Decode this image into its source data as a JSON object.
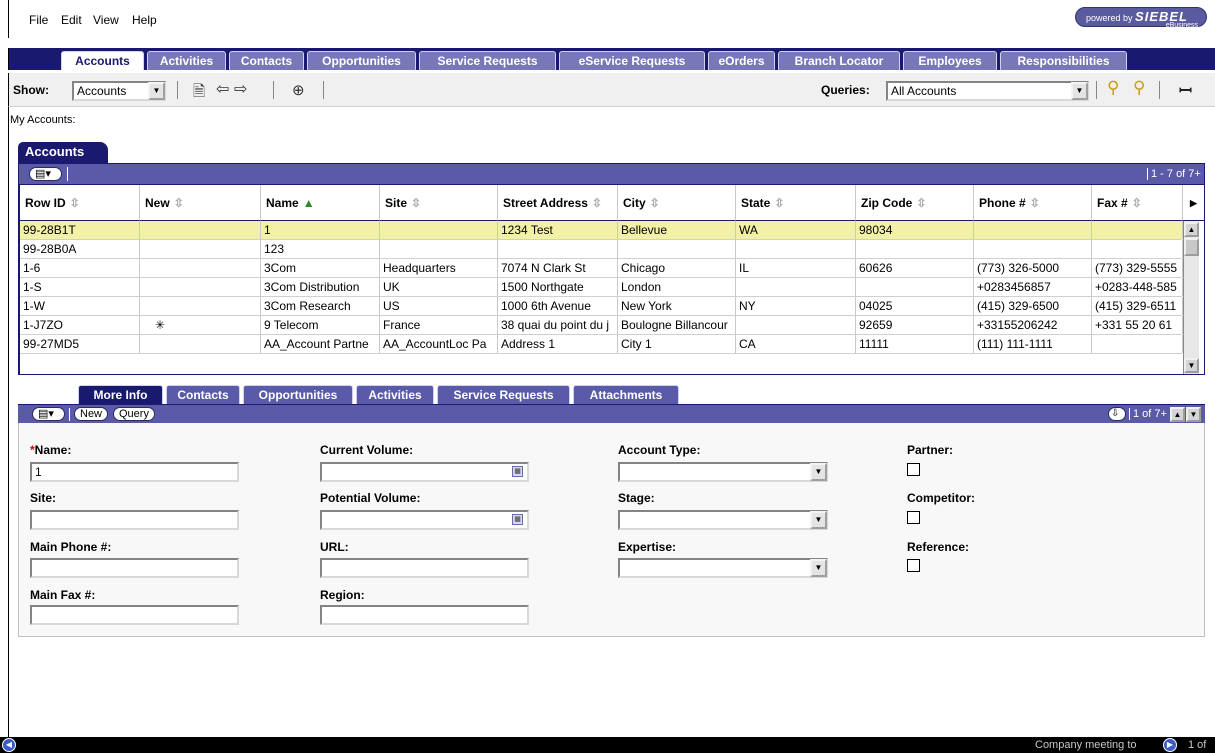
{
  "menu": [
    "File",
    "Edit",
    "View",
    "Help"
  ],
  "brand": {
    "prefix": "powered by",
    "name": "SIEBEL",
    "sub": "eBusiness"
  },
  "tabs": [
    "Accounts",
    "Activities",
    "Contacts",
    "Opportunities",
    "Service Requests",
    "eService Requests",
    "eOrders",
    "Branch Locator",
    "Employees",
    "Responsibilities"
  ],
  "toolbar": {
    "show_label": "Show:",
    "show_value": "Accounts",
    "queries_label": "Queries:",
    "queries_value": "All Accounts"
  },
  "breadcrumb": "My Accounts:",
  "list_applet": {
    "title": "Accounts",
    "record_count": "1 - 7 of 7+",
    "columns": [
      "Row ID",
      "New",
      "Name",
      "Site",
      "Street Address",
      "City",
      "State",
      "Zip Code",
      "Phone #",
      "Fax #"
    ],
    "sorted_column": "Name",
    "rows": [
      {
        "row_id": "99-28B1T",
        "new": "",
        "name": "1",
        "site": "",
        "street": "1234 Test",
        "city": "Bellevue",
        "state": "WA",
        "zip": "98034",
        "phone": "",
        "fax": ""
      },
      {
        "row_id": "99-28B0A",
        "new": "",
        "name": "123",
        "site": "",
        "street": "",
        "city": "",
        "state": "",
        "zip": "",
        "phone": "",
        "fax": ""
      },
      {
        "row_id": "1-6",
        "new": "",
        "name": "3Com",
        "site": "Headquarters",
        "street": "7074 N Clark St",
        "city": "Chicago",
        "state": "IL",
        "zip": "60626",
        "phone": "(773) 326-5000",
        "fax": "(773) 329-5555"
      },
      {
        "row_id": "1-S",
        "new": "",
        "name": "3Com Distribution",
        "site": "UK",
        "street": "1500 Northgate",
        "city": "London",
        "state": "",
        "zip": "",
        "phone": "+0283456857",
        "fax": "+0283-448-585"
      },
      {
        "row_id": "1-W",
        "new": "",
        "name": "3Com Research",
        "site": "US",
        "street": "1000 6th Avenue",
        "city": "New York",
        "state": "NY",
        "zip": "04025",
        "phone": "(415) 329-6500",
        "fax": "(415) 329-6511"
      },
      {
        "row_id": "1-J7ZO",
        "new": "✳",
        "name": "9 Telecom",
        "site": "France",
        "street": "38 quai du point du j",
        "city": "Boulogne Billancour",
        "state": "",
        "zip": "92659",
        "phone": "+33155206242",
        "fax": "+331 55 20 61"
      },
      {
        "row_id": "99-27MD5",
        "new": "",
        "name": "AA_Account Partne",
        "site": "AA_AccountLoc Pa",
        "street": "Address 1",
        "city": "City 1",
        "state": "CA",
        "zip": "11111",
        "phone": "(111) 111-1111",
        "fax": ""
      }
    ]
  },
  "form_tabs": [
    "More Info",
    "Contacts",
    "Opportunities",
    "Activities",
    "Service Requests",
    "Attachments"
  ],
  "form": {
    "menu_btn": "▤▾",
    "new_btn": "New",
    "query_btn": "Query",
    "record_count": "1 of 7+",
    "required_mark": "*",
    "name_label": "Name:",
    "name_value": "1",
    "site_label": "Site:",
    "main_phone_label": "Main Phone #:",
    "main_fax_label": "Main Fax #:",
    "current_volume_label": "Current Volume:",
    "potential_volume_label": "Potential Volume:",
    "url_label": "URL:",
    "region_label": "Region:",
    "account_type_label": "Account Type:",
    "stage_label": "Stage:",
    "expertise_label": "Expertise:",
    "partner_label": "Partner:",
    "competitor_label": "Competitor:",
    "reference_label": "Reference:"
  },
  "status": {
    "text": "Company meeting to",
    "page": "1 of"
  },
  "colors": {
    "navy": "#191970",
    "purple": "#5a5aa8",
    "selected_row": "#f3f0a8"
  }
}
